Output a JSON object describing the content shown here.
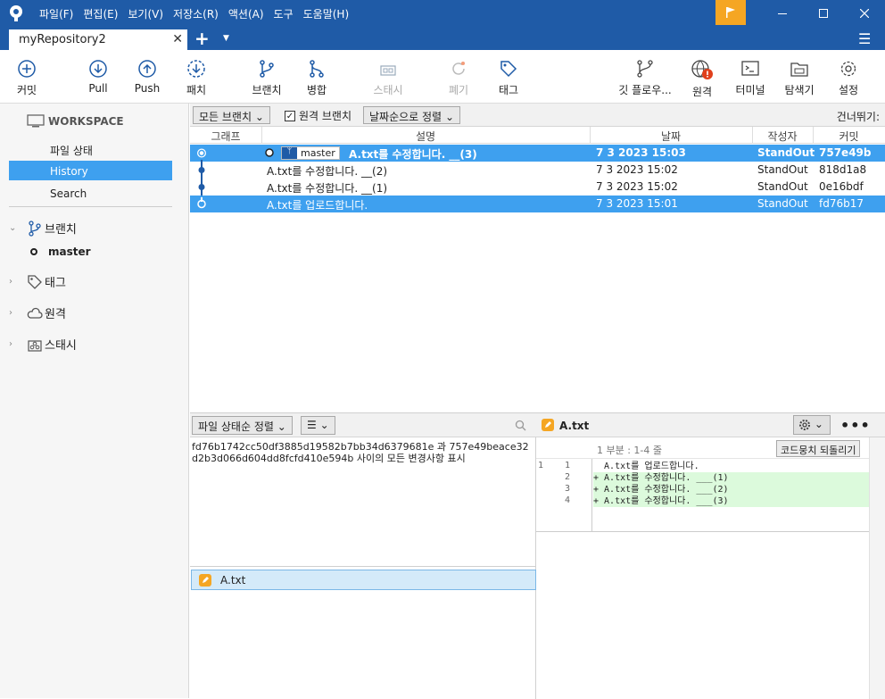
{
  "window": {
    "menu": [
      "파일(F)",
      "편집(E)",
      "보기(V)",
      "저장소(R)",
      "액션(A)",
      "도구",
      "도움말(H)"
    ]
  },
  "tabs": {
    "active": "myRepository2",
    "close": "✕",
    "add": "+"
  },
  "toolbar": {
    "commit": "커밋",
    "pull": "Pull",
    "push": "Push",
    "fetch": "패치",
    "branch": "브랜치",
    "merge": "병합",
    "stash": "스태시",
    "discard": "폐기",
    "tag": "태그",
    "gitflow": "깃 플로우...",
    "remote": "원격",
    "terminal": "터미널",
    "explorer": "탐색기",
    "settings": "설정"
  },
  "sidebar": {
    "workspace": "WORKSPACE",
    "file_status": "파일 상태",
    "history": "History",
    "search": "Search",
    "branches": "브랜치",
    "master": "master",
    "tags": "태그",
    "remotes": "원격",
    "stashes": "스태시"
  },
  "filter": {
    "branches": "모든 브랜치",
    "remote_branches": "원격 브랜치",
    "sort": "날짜순으로 정렬",
    "jump": "건너뛰기:"
  },
  "columns": {
    "graph": "그래프",
    "desc": "설명",
    "date": "날짜",
    "author": "작성자",
    "commit": "커밋"
  },
  "commits": [
    {
      "branch": "master",
      "desc": "A.txt를 수정합니다. __(3)",
      "date": "7 3 2023 15:03",
      "author": "StandOut",
      "hash": "757e49b"
    },
    {
      "branch": "",
      "desc": "A.txt를 수정합니다. __(2)",
      "date": "7 3 2023 15:02",
      "author": "StandOut",
      "hash": "818d1a8"
    },
    {
      "branch": "",
      "desc": "A.txt를 수정합니다. __(1)",
      "date": "7 3 2023 15:02",
      "author": "StandOut",
      "hash": "0e16bdf"
    },
    {
      "branch": "",
      "desc": "A.txt를 업로드합니다.",
      "date": "7 3 2023 15:01",
      "author": "StandOut",
      "hash": "fd76b17"
    }
  ],
  "files": {
    "sort": "파일 상태순 정렬",
    "view": "☰",
    "summary": "fd76b1742cc50df3885d19582b7bb34d6379681e 과 757e49beace32d2b3d066d604dd8fcfd410e594b 사이의 모든 변경사항 표시",
    "file": "A.txt"
  },
  "diff": {
    "file": "A.txt",
    "hunk": "1 부분 : 1-4 줄",
    "revert": "코드뭉치 되돌리기",
    "lines": [
      {
        "old": "1",
        "new": "1",
        "text": "  A.txt를 업로드합니다."
      },
      {
        "old": "",
        "new": "2",
        "text": "+ A.txt를 수정합니다. ___(1)"
      },
      {
        "old": "",
        "new": "3",
        "text": "+ A.txt를 수정합니다. ___(2)"
      },
      {
        "old": "",
        "new": "4",
        "text": "+ A.txt를 수정합니다. ___(3)"
      }
    ]
  },
  "colors": {
    "accent": "#1f5ba7",
    "selection": "#3ea0ef",
    "flag": "#f5a623",
    "added": "#dcfadc"
  }
}
